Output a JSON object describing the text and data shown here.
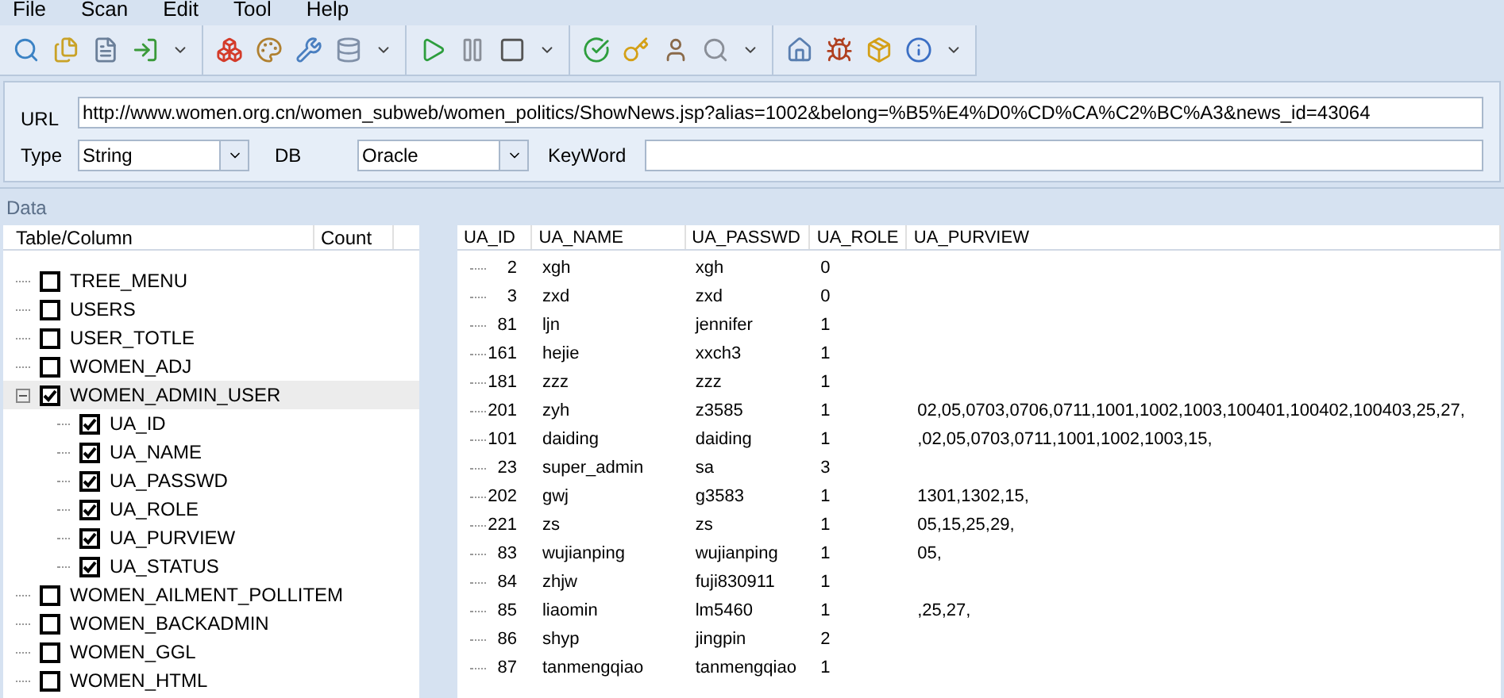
{
  "menu": [
    "File",
    "Scan",
    "Edit",
    "Tool",
    "Help"
  ],
  "form": {
    "url_label": "URL",
    "url": "http://www.women.org.cn/women_subweb/women_politics/ShowNews.jsp?alias=1002&belong=%B5%E4%D0%CD%CA%C2%BC%A3&news_id=43064",
    "type_label": "Type",
    "type": "String",
    "db_label": "DB",
    "db": "Oracle",
    "keyword_label": "KeyWord"
  },
  "data_title": "Data",
  "tree": {
    "columns": [
      "Table/Column",
      "Count"
    ],
    "items": [
      {
        "label": "TREE_MENU",
        "checked": false,
        "selected": false
      },
      {
        "label": "USERS",
        "checked": false,
        "selected": false
      },
      {
        "label": "USER_TOTLE",
        "checked": false,
        "selected": false
      },
      {
        "label": "WOMEN_ADJ",
        "checked": false,
        "selected": false
      },
      {
        "label": "WOMEN_ADMIN_USER",
        "checked": true,
        "selected": true,
        "expanded": true,
        "children": [
          {
            "label": "UA_ID",
            "checked": true
          },
          {
            "label": "UA_NAME",
            "checked": true
          },
          {
            "label": "UA_PASSWD",
            "checked": true
          },
          {
            "label": "UA_ROLE",
            "checked": true
          },
          {
            "label": "UA_PURVIEW",
            "checked": true
          },
          {
            "label": "UA_STATUS",
            "checked": true
          }
        ]
      },
      {
        "label": "WOMEN_AILMENT_POLLITEM",
        "checked": false,
        "selected": false
      },
      {
        "label": "WOMEN_BACKADMIN",
        "checked": false,
        "selected": false
      },
      {
        "label": "WOMEN_GGL",
        "checked": false,
        "selected": false
      },
      {
        "label": "WOMEN_HTML",
        "checked": false,
        "selected": false
      }
    ]
  },
  "table": {
    "columns": [
      "UA_ID",
      "UA_NAME",
      "UA_PASSWD",
      "UA_ROLE",
      "UA_PURVIEW"
    ],
    "rows": [
      [
        "2",
        "xgh",
        "xgh",
        "0",
        ""
      ],
      [
        "3",
        "zxd",
        "zxd",
        "0",
        ""
      ],
      [
        "81",
        "ljn",
        "jennifer",
        "1",
        ""
      ],
      [
        "161",
        "hejie",
        "xxch3",
        "1",
        ""
      ],
      [
        "181",
        "zzz",
        "zzz",
        "1",
        ""
      ],
      [
        "201",
        "zyh",
        "z3585",
        "1",
        "02,05,0703,0706,0711,1001,1002,1003,100401,100402,100403,25,27,"
      ],
      [
        "101",
        "daiding",
        "daiding",
        "1",
        ",02,05,0703,0711,1001,1002,1003,15,"
      ],
      [
        "23",
        "super_admin",
        "sa",
        "3",
        ""
      ],
      [
        "202",
        "gwj",
        "g3583",
        "1",
        "1301,1302,15,"
      ],
      [
        "221",
        "zs",
        "zs",
        "1",
        "05,15,25,29,"
      ],
      [
        "83",
        "wujianping",
        "wujianping",
        "1",
        "05,"
      ],
      [
        "84",
        "zhjw",
        "fuji830911",
        "1",
        ""
      ],
      [
        "85",
        "liaomin",
        "lm5460",
        "1",
        ",25,27,"
      ],
      [
        "86",
        "shyp",
        "jingpin",
        "2",
        ""
      ],
      [
        "87",
        "tanmengqiao",
        "tanmengqiao",
        "1",
        ""
      ]
    ]
  }
}
